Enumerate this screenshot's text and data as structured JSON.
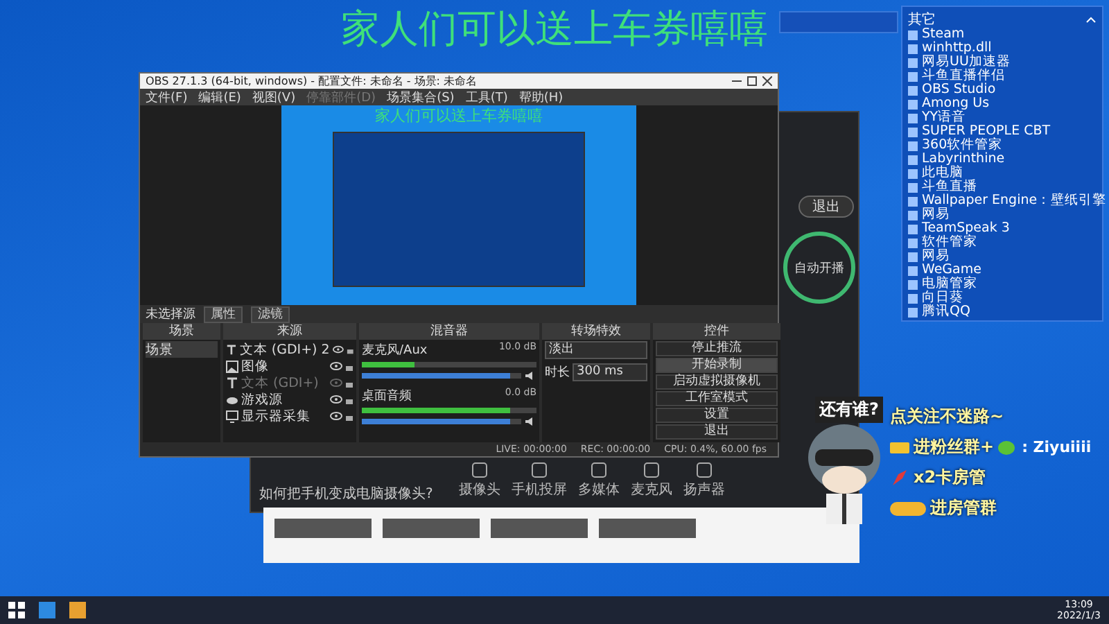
{
  "banner": "家人们可以送上车券嘻嘻",
  "other_panel": {
    "title": "其它",
    "items": [
      "Steam",
      "winhttp.dll",
      "网易UU加速器",
      "斗鱼直播伴侣",
      "OBS Studio",
      "Among Us",
      "YY语音",
      "SUPER PEOPLE CBT",
      "360软件管家",
      "Labyrinthine",
      "此电脑",
      "斗鱼直播",
      "Wallpaper Engine：壁纸引擎",
      "网易",
      "TeamSpeak 3",
      "软件管家",
      "网易",
      "WeGame",
      "电脑管家",
      "向日葵",
      "腾讯QQ"
    ]
  },
  "obs": {
    "title": "OBS 27.1.3 (64-bit, windows) - 配置文件: 未命名 - 场景: 未命名",
    "menu": [
      "文件(F)",
      "编辑(E)",
      "视图(V)",
      "停靠部件(D)",
      "场景集合(S)",
      "工具(T)",
      "帮助(H)"
    ],
    "preview_banner": "家人们可以送上车券嘻嘻",
    "source_bar": {
      "label": "未选择源",
      "buttons": [
        "属性",
        "滤镜"
      ]
    },
    "scenes": {
      "title": "场景",
      "items": [
        {
          "label": "场景",
          "selected": true
        }
      ]
    },
    "sources": {
      "title": "来源",
      "items": [
        {
          "kind": "text",
          "label": "文本 (GDI+) 2",
          "visible": true
        },
        {
          "kind": "image",
          "label": "图像",
          "visible": true
        },
        {
          "kind": "text",
          "label": "文本 (GDI+)",
          "visible": false
        },
        {
          "kind": "game",
          "label": "游戏源",
          "visible": true
        },
        {
          "kind": "display",
          "label": "显示器采集",
          "visible": true
        }
      ]
    },
    "mixer": {
      "title": "混音器",
      "channels": [
        {
          "name": "麦克风/Aux",
          "reading": "10.0 dB",
          "meter": {
            "level": 0.3
          },
          "fader": {
            "level": 0.93
          }
        },
        {
          "name": "桌面音频",
          "reading": "0.0 dB",
          "meter": {
            "level": 0.85
          },
          "fader": {
            "level": 0.93
          }
        }
      ]
    },
    "transitions": {
      "title": "转场特效",
      "type": "淡出",
      "duration_label": "时长",
      "duration": "300 ms"
    },
    "controls": {
      "title": "控件",
      "buttons": [
        {
          "label": "停止推流",
          "hovered": false
        },
        {
          "label": "开始录制",
          "hovered": true
        },
        {
          "label": "启动虚拟摄像机",
          "hovered": false
        },
        {
          "label": "工作室模式",
          "hovered": false
        },
        {
          "label": "设置",
          "hovered": false
        },
        {
          "label": "退出",
          "hovered": false
        }
      ]
    },
    "status": [
      "LIVE: 00:00:00",
      "REC: 00:00:00",
      "CPU: 0.4%, 60.00 fps"
    ]
  },
  "companion": {
    "exit": "退出",
    "auto": "自动开播",
    "tools": [
      "摄像头",
      "手机投屏",
      "多媒体",
      "麦克风",
      "扬声器"
    ],
    "tip": "如何把手机变成电脑摄像头?"
  },
  "overlay": {
    "bubble": "还有谁?",
    "lines": [
      {
        "kind": "plain",
        "text": "点关注不迷路~"
      },
      {
        "kind": "group",
        "text": "进粉丝群+",
        "extra": ": Ziyuiiii"
      },
      {
        "kind": "rocket",
        "text": "x2卡房管"
      },
      {
        "kind": "badge",
        "text": "进房管群"
      }
    ]
  },
  "taskbar": {
    "time": "13:09",
    "date": "2022/1/3"
  }
}
